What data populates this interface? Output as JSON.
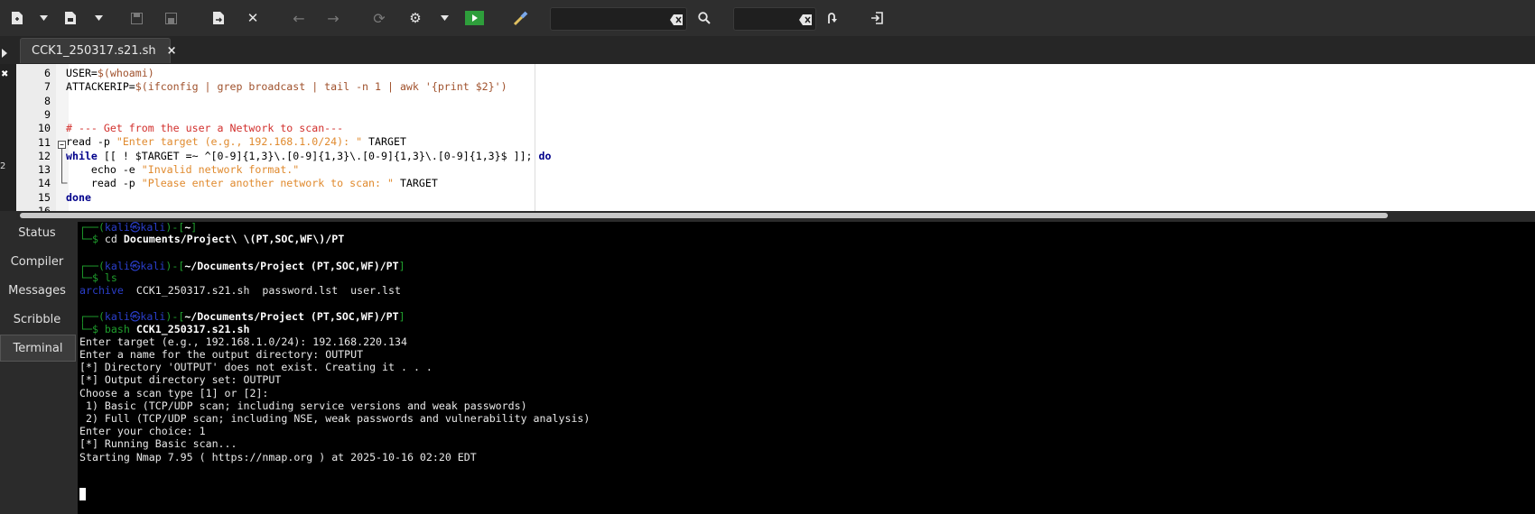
{
  "toolbar": {
    "icons": [
      "new-file-icon",
      "dropdown-arrow-icon",
      "open-file-icon",
      "dropdown-arrow-icon",
      "save-icon",
      "save-all-icon",
      "reload-icon",
      "close-icon",
      "back-icon",
      "forward-icon",
      "refresh-icon",
      "gear-icon",
      "dropdown-arrow-icon",
      "run-icon",
      "color-picker-icon",
      "search-icon",
      "jump-icon",
      "exit-icon"
    ],
    "search_value": "",
    "goto_value": ""
  },
  "tabs": [
    {
      "label": "CCK1_250317.s21.sh",
      "close": "×"
    }
  ],
  "editor": {
    "lines": [
      {
        "n": "6",
        "parts": [
          {
            "t": "USER=",
            "c": ""
          },
          {
            "t": "$(whoami)",
            "c": "c-var"
          }
        ]
      },
      {
        "n": "7",
        "parts": [
          {
            "t": "ATTACKERIP=",
            "c": ""
          },
          {
            "t": "$(ifconfig | grep broadcast | tail -n 1 | awk '{print $2}')",
            "c": "c-var"
          }
        ]
      },
      {
        "n": "8",
        "parts": []
      },
      {
        "n": "9",
        "parts": []
      },
      {
        "n": "10",
        "parts": [
          {
            "t": "# --- Get from the user a Network to scan---",
            "c": "c-cmt"
          }
        ]
      },
      {
        "n": "11",
        "parts": [
          {
            "t": "read -p ",
            "c": ""
          },
          {
            "t": "\"Enter target (e.g., 192.168.1.0/24): \"",
            "c": "c-str"
          },
          {
            "t": " TARGET",
            "c": ""
          }
        ]
      },
      {
        "n": "12",
        "parts": [
          {
            "t": "while",
            "c": "c-kw"
          },
          {
            "t": " [[ ! $TARGET =~ ^[0-9]{1,3}\\.[0-9]{1,3}\\.[0-9]{1,3}\\.[0-9]{1,3}$ ]]; ",
            "c": ""
          },
          {
            "t": "do",
            "c": "c-kw"
          }
        ]
      },
      {
        "n": "13",
        "parts": [
          {
            "t": "    echo -e ",
            "c": ""
          },
          {
            "t": "\"Invalid network format.\"",
            "c": "c-str"
          }
        ]
      },
      {
        "n": "14",
        "parts": [
          {
            "t": "    read -p ",
            "c": ""
          },
          {
            "t": "\"Please enter another network to scan: \"",
            "c": "c-str"
          },
          {
            "t": " TARGET",
            "c": ""
          }
        ]
      },
      {
        "n": "15",
        "parts": [
          {
            "t": "done",
            "c": "c-kw"
          }
        ]
      },
      {
        "n": "16",
        "parts": []
      }
    ]
  },
  "sidebar": {
    "items": [
      {
        "label": "Status"
      },
      {
        "label": "Compiler"
      },
      {
        "label": "Messages"
      },
      {
        "label": "Scribble"
      },
      {
        "label": "Terminal",
        "active": true
      }
    ]
  },
  "terminal": {
    "lines": [
      {
        "parts": [
          {
            "t": "┌──(",
            "c": "g"
          },
          {
            "t": "kali㉿kali",
            "c": "b"
          },
          {
            "t": ")-[",
            "c": "g"
          },
          {
            "t": "~",
            "c": "bold"
          },
          {
            "t": "]",
            "c": "g"
          }
        ]
      },
      {
        "parts": [
          {
            "t": "└─$ ",
            "c": "g"
          },
          {
            "t": "cd ",
            "c": ""
          },
          {
            "t": "Documents/Project\\ \\(PT,SOC,WF\\)/PT",
            "c": "bold"
          }
        ]
      },
      {
        "parts": []
      },
      {
        "parts": [
          {
            "t": "┌──(",
            "c": "g"
          },
          {
            "t": "kali㉿kali",
            "c": "b"
          },
          {
            "t": ")-[",
            "c": "g"
          },
          {
            "t": "~/Documents/Project (PT,SOC,WF)/PT",
            "c": "bold"
          },
          {
            "t": "]",
            "c": "g"
          }
        ]
      },
      {
        "parts": [
          {
            "t": "└─$ ",
            "c": "g"
          },
          {
            "t": "ls",
            "c": "g"
          }
        ]
      },
      {
        "parts": [
          {
            "t": "archive",
            "c": "b"
          },
          {
            "t": "  CCK1_250317.s21.sh  password.lst  user.lst",
            "c": ""
          }
        ]
      },
      {
        "parts": []
      },
      {
        "parts": [
          {
            "t": "┌──(",
            "c": "g"
          },
          {
            "t": "kali㉿kali",
            "c": "b"
          },
          {
            "t": ")-[",
            "c": "g"
          },
          {
            "t": "~/Documents/Project (PT,SOC,WF)/PT",
            "c": "bold"
          },
          {
            "t": "]",
            "c": "g"
          }
        ]
      },
      {
        "parts": [
          {
            "t": "└─$ ",
            "c": "g"
          },
          {
            "t": "bash ",
            "c": "g"
          },
          {
            "t": "CCK1_250317.s21.sh",
            "c": "bold"
          }
        ]
      },
      {
        "parts": [
          {
            "t": "Enter target (e.g., 192.168.1.0/24): 192.168.220.134",
            "c": ""
          }
        ]
      },
      {
        "parts": [
          {
            "t": "Enter a name for the output directory: OUTPUT",
            "c": ""
          }
        ]
      },
      {
        "parts": [
          {
            "t": "[*] Directory 'OUTPUT' does not exist. Creating it . . .",
            "c": ""
          }
        ]
      },
      {
        "parts": [
          {
            "t": "[*] Output directory set: OUTPUT",
            "c": ""
          }
        ]
      },
      {
        "parts": [
          {
            "t": "Choose a scan type [1] or [2]:",
            "c": ""
          }
        ]
      },
      {
        "parts": [
          {
            "t": " 1) Basic (TCP/UDP scan; including service versions and weak passwords)",
            "c": ""
          }
        ]
      },
      {
        "parts": [
          {
            "t": " 2) Full (TCP/UDP scan; including NSE, weak passwords and vulnerability analysis)",
            "c": ""
          }
        ]
      },
      {
        "parts": [
          {
            "t": "Enter your choice: 1",
            "c": ""
          }
        ]
      },
      {
        "parts": [
          {
            "t": "[*] Running Basic scan...",
            "c": ""
          }
        ]
      },
      {
        "parts": [
          {
            "t": "Starting Nmap 7.95 ( https://nmap.org ) at 2025-10-16 02:20 EDT",
            "c": ""
          }
        ]
      }
    ]
  },
  "colors": {
    "accent_run": "#2e9e3b",
    "terminal_prompt": "#1f9e2d",
    "terminal_user": "#2a3ec9"
  }
}
